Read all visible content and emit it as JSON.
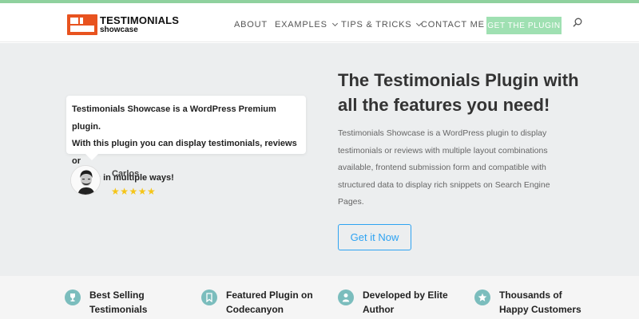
{
  "brand": {
    "logo_line1": "TESTIMONIALS",
    "logo_line2": "showcase",
    "accent_color": "#8fd19e",
    "logo_color": "#e8531f"
  },
  "nav": {
    "items": [
      {
        "label": "ABOUT",
        "has_dropdown": false
      },
      {
        "label": "EXAMPLES",
        "has_dropdown": true
      },
      {
        "label": "TIPS & TRICKS",
        "has_dropdown": true
      },
      {
        "label": "CONTACT ME",
        "has_dropdown": false
      }
    ],
    "cta_label": "GET THE PLUGIN",
    "search_icon": "search-icon"
  },
  "testimonial": {
    "quote_lines": [
      "Testimonials Showcase is a WordPress Premium plugin.",
      "With this plugin you can display testimonials, reviews or",
      "quotes in multiple ways!"
    ],
    "author": "Carlos",
    "stars": "★★★★★",
    "rating": 5
  },
  "hero": {
    "title_lines": [
      "The Testimonials Plugin with",
      "all the features you need!"
    ],
    "description_lines": [
      "Testimonials Showcase is a WordPress plugin to display",
      "testimonials or reviews with multiple layout combinations",
      "available, frontend submission form and compatible with",
      "structured data to display rich snippets on Search Engine",
      "Pages."
    ],
    "cta_label": "Get it Now",
    "cta_color": "#2ea3f2"
  },
  "features": [
    {
      "icon": "trophy-icon",
      "line1": "Best Selling",
      "line2": "Testimonials"
    },
    {
      "icon": "bookmark-icon",
      "line1": "Featured Plugin on",
      "line2": "Codecanyon"
    },
    {
      "icon": "user-icon",
      "line1": "Developed by Elite",
      "line2": "Author"
    },
    {
      "icon": "star-icon",
      "line1": "Thousands of",
      "line2": "Happy Customers"
    }
  ]
}
